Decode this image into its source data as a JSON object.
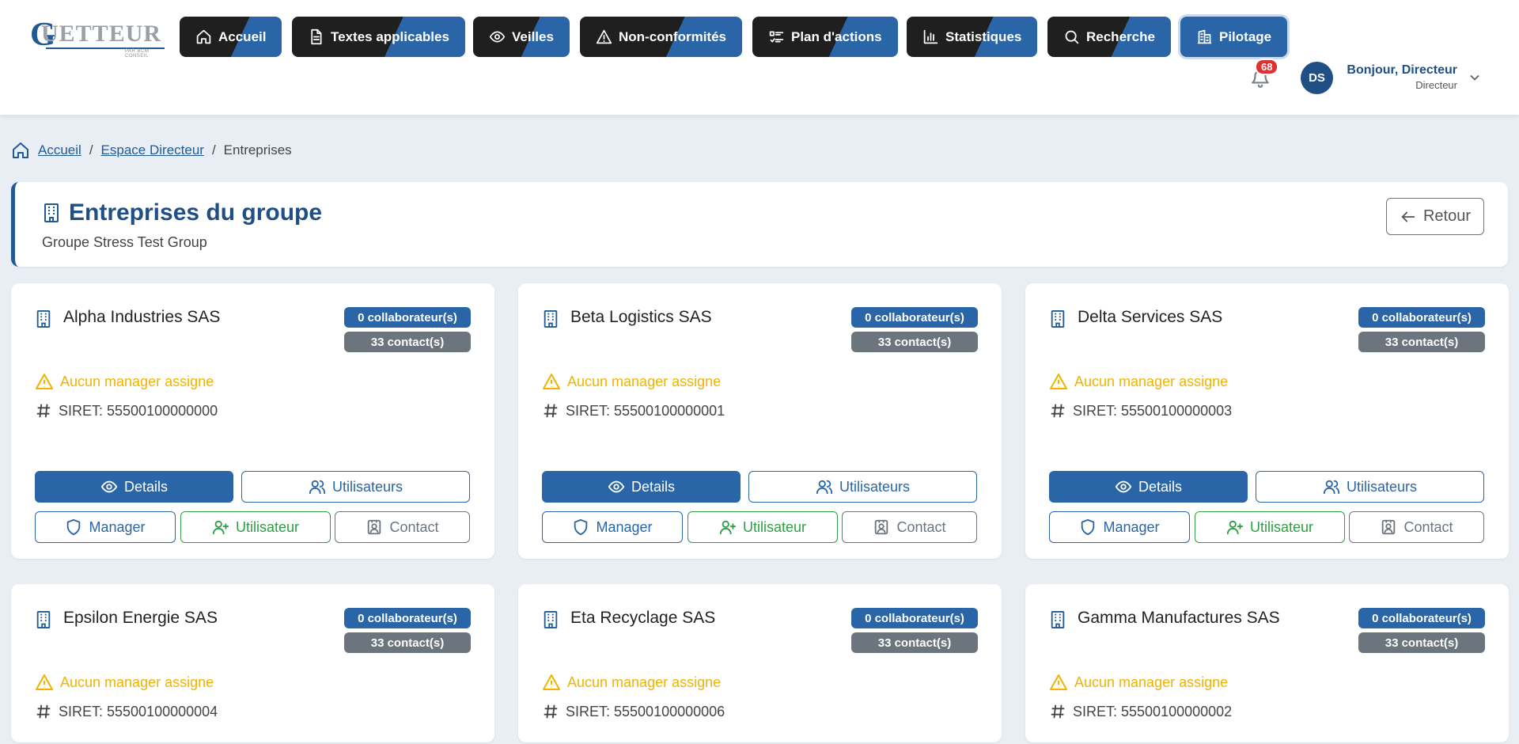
{
  "header": {
    "logo": {
      "text": "UETTEUR",
      "initial": "G",
      "tagline": "PAR BCM CONSEIL"
    },
    "nav": [
      {
        "label": "Accueil",
        "icon": "home-icon"
      },
      {
        "label": "Textes applicables",
        "icon": "document-icon"
      },
      {
        "label": "Veilles",
        "icon": "eye-icon"
      },
      {
        "label": "Non-conformités",
        "icon": "warning-icon"
      },
      {
        "label": "Plan d'actions",
        "icon": "checklist-icon"
      },
      {
        "label": "Statistiques",
        "icon": "bar-chart-icon"
      },
      {
        "label": "Recherche",
        "icon": "search-icon"
      },
      {
        "label": "Pilotage",
        "icon": "buildings-icon",
        "active": true
      }
    ],
    "notifications": {
      "count": "68"
    },
    "user": {
      "initials": "DS",
      "greeting": "Bonjour, Directeur",
      "role": "Directeur"
    }
  },
  "breadcrumb": {
    "home": "Accueil",
    "parent": "Espace Directeur",
    "current": "Entreprises",
    "separator": "/"
  },
  "page": {
    "title": "Entreprises du groupe",
    "subtitle": "Groupe Stress Test Group",
    "back_label": "Retour"
  },
  "labels": {
    "details": "Details",
    "users": "Utilisateurs",
    "manager": "Manager",
    "add_user": "Utilisateur",
    "contact": "Contact",
    "no_manager": "Aucun manager assigne"
  },
  "companies": [
    {
      "name": "Alpha Industries SAS",
      "collaborators": "0 collaborateur(s)",
      "contacts": "33 contact(s)",
      "siret": "SIRET: 55500100000000"
    },
    {
      "name": "Beta Logistics SAS",
      "collaborators": "0 collaborateur(s)",
      "contacts": "33 contact(s)",
      "siret": "SIRET: 55500100000001"
    },
    {
      "name": "Delta Services SAS",
      "collaborators": "0 collaborateur(s)",
      "contacts": "33 contact(s)",
      "siret": "SIRET: 55500100000003"
    },
    {
      "name": "Epsilon Energie SAS",
      "collaborators": "0 collaborateur(s)",
      "contacts": "33 contact(s)",
      "siret": "SIRET: 55500100000004"
    },
    {
      "name": "Eta Recyclage SAS",
      "collaborators": "0 collaborateur(s)",
      "contacts": "33 contact(s)",
      "siret": "SIRET: 55500100000006"
    },
    {
      "name": "Gamma Manufactures SAS",
      "collaborators": "0 collaborateur(s)",
      "contacts": "33 contact(s)",
      "siret": "SIRET: 55500100000002"
    }
  ],
  "colors": {
    "primary": "#2a65a8",
    "dark": "#1f1f1f",
    "warning": "#f0b400",
    "success": "#2f9e44",
    "muted": "#6c757d",
    "notification": "#e03131"
  }
}
